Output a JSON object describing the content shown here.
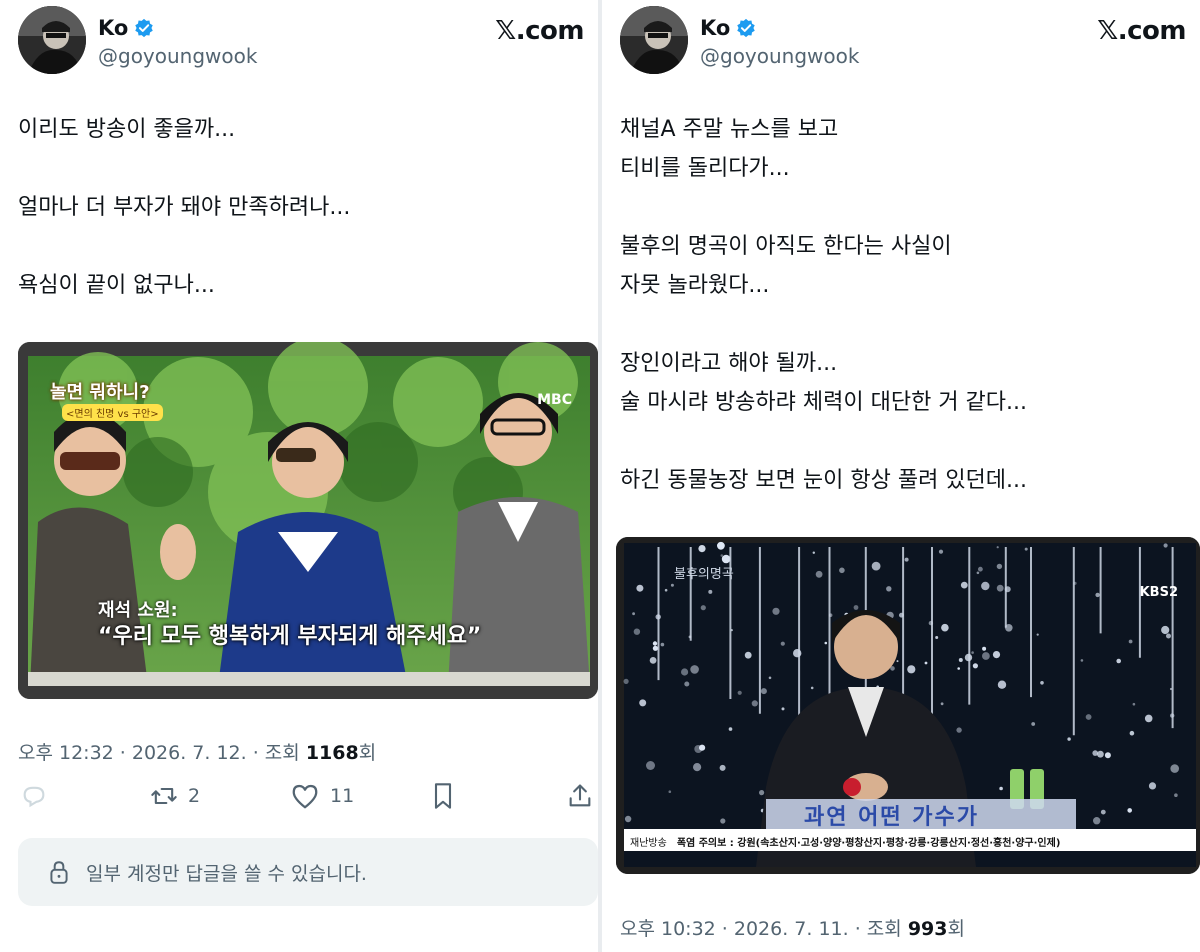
{
  "left": {
    "author": {
      "name": "Ko",
      "handle": "@goyoungwook"
    },
    "brand": "𝕏.com",
    "paragraphs": [
      "이리도 방송이 좋을까...",
      "얼마나 더 부자가 돼야 만족하려나...",
      "욕심이 끝이 없구나..."
    ],
    "media": {
      "show_logo": "놀면 뭐하니?",
      "show_sub": "<면의 친명 vs 구안>",
      "channel": "MBC",
      "caption_small": "재석 소원:",
      "caption_big": "“우리 모두 행복하게 부자되게 해주세요”"
    },
    "meta": {
      "time": "오후 12:32 · 2026. 7. 12. · 조회 ",
      "views": "1168",
      "suffix": "회"
    },
    "actions": {
      "retweets": "2",
      "likes": "11"
    },
    "reply_notice": "일부 계정만 답글을 쓸 수 있습니다."
  },
  "right": {
    "author": {
      "name": "Ko",
      "handle": "@goyoungwook"
    },
    "brand": "𝕏.com",
    "paragraphs": [
      "채널A 주말 뉴스를 보고\n티비를 돌리다가...",
      "불후의 명곡이 아직도 한다는 사실이\n자못 놀라웠다...",
      "장인이라고 해야 될까...\n술 마시랴 방송하랴 체력이 대단한 거 같다...",
      "하긴 동물농장 보면 눈이 항상 풀려 있던데..."
    ],
    "media": {
      "show_logo": "불후의명곡",
      "channel": "KBS2",
      "caption_big": "과연 어떤 가수가",
      "ticker_label": "재난방송",
      "ticker_text": "폭염 주의보 : 강원(속초산지·고성·양양·평창산지·평창·강릉·강릉산지·정선·홍천·양구·인제)"
    },
    "meta": {
      "time": "오후 10:32 · 2026. 7. 11. · 조회 ",
      "views": "993",
      "suffix": "회"
    }
  },
  "colors": {
    "verified": "#1d9bf0",
    "text": "#0f1419",
    "secondary": "#536471",
    "reply_bg": "#eff3f4"
  }
}
